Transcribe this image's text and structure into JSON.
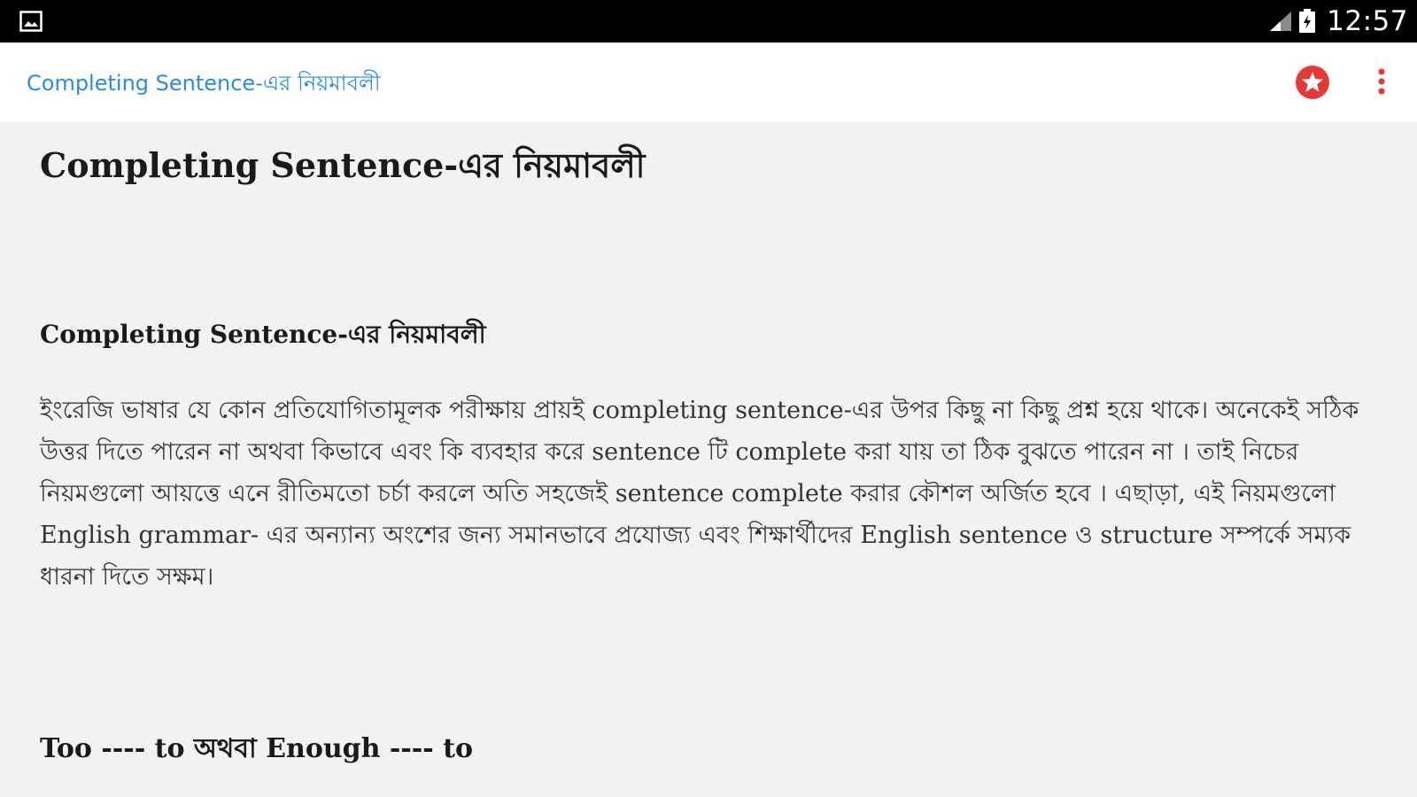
{
  "status_bar": {
    "time": "12:57",
    "left_icon": "image-icon",
    "signal_icon": "signal-icon",
    "battery_icon": "battery-icon"
  },
  "app_bar": {
    "title": "Completing Sentence-এর নিয়মাবলী",
    "favorite_icon": "star-icon",
    "menu_icon": "more-vert-icon",
    "accent_color": "#2a8be8",
    "favorite_color": "#e53935"
  },
  "article": {
    "title": "Completing Sentence-এর নিয়মাবলী",
    "section_heading": "Completing Sentence-এর নিয়মাবলী",
    "intro_paragraph": "ইংরেজি ভাষার যে কোন প্রতিযোগিতামূলক পরীক্ষায় প্রায়ই completing sentence-এর উপর কিছু না কিছু প্রশ্ন হয়ে থাকে। অনেকেই সঠিক উত্তর দিতে পারেন না অথবা কিভাবে এবং কি ব্যবহার করে sentence টি complete করা যায় তা ঠিক বুঝতে পারেন না । তাই নিচের নিয়মগুলো আয়ত্তে এনে রীতিমতো চর্চা করলে অতি সহজেই sentence complete করার কৌশল অর্জিত হবে । এছাড়া, এই নিয়মগুলো English grammar- এর অন্যান্য অংশের জন্য সমানভাবে প্রযোজ্য এবং শিক্ষার্থীদের English sentence ও structure সম্পর্কে সম্যক ধারনা দিতে সক্ষম।",
    "rule_heading": "Too ---- to অথবা Enough ---- to"
  }
}
